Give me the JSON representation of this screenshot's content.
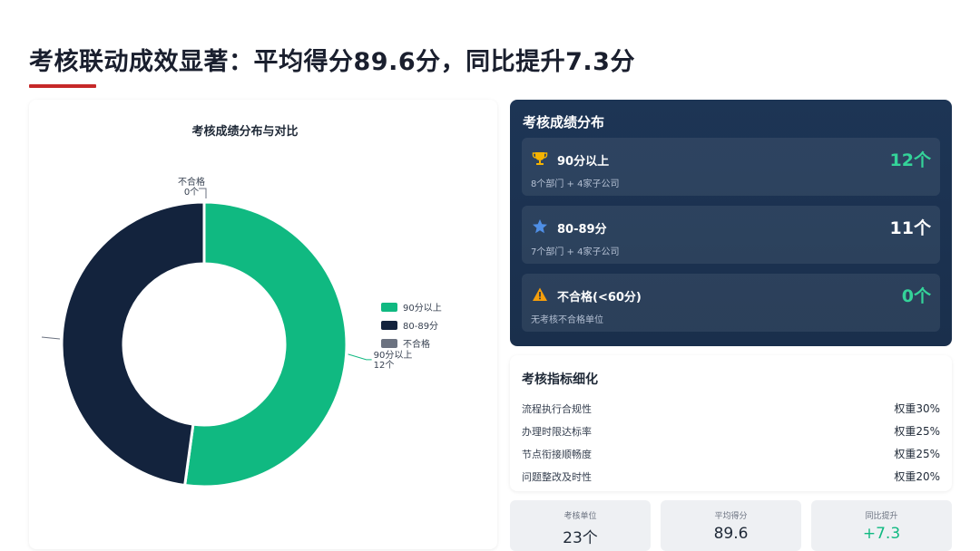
{
  "page": {
    "title": "考核联动成效显著：平均得分89.6分，同比提升7.3分"
  },
  "chart_data": {
    "type": "pie",
    "title": "考核成绩分布与对比",
    "categories": [
      "90分以上",
      "80-89分",
      "不合格"
    ],
    "values": [
      12,
      11,
      0
    ],
    "colors": [
      "#10b981",
      "#13233d",
      "#6b7280"
    ],
    "unit": "个",
    "donut": true,
    "legend": "right",
    "labels": [
      {
        "name": "90分以上",
        "value": "12个"
      },
      {
        "name": "不合格",
        "value": "0个"
      }
    ]
  },
  "distribution": {
    "title": "考核成绩分布",
    "items": [
      {
        "label": "90分以上",
        "sub": "8个部门 + 4家子公司",
        "count": "12个",
        "icon": "trophy-icon",
        "color": "#34d399"
      },
      {
        "label": "80-89分",
        "sub": "7个部门 + 4家子公司",
        "count": "11个",
        "icon": "star-icon",
        "color": "#ffffff"
      },
      {
        "label": "不合格(<60分)",
        "sub": "无考核不合格单位",
        "count": "0个",
        "icon": "warning-icon",
        "color": "#34d399"
      }
    ]
  },
  "indicators": {
    "title": "考核指标细化",
    "rows": [
      {
        "name": "流程执行合规性",
        "weight": "权重30%"
      },
      {
        "name": "办理时限达标率",
        "weight": "权重25%"
      },
      {
        "name": "节点衔接顺畅度",
        "weight": "权重25%"
      },
      {
        "name": "问题整改及时性",
        "weight": "权重20%"
      }
    ]
  },
  "stats": [
    {
      "label": "考核单位",
      "value": "23个"
    },
    {
      "label": "平均得分",
      "value": "89.6"
    },
    {
      "label": "同比提升",
      "value": "+7.3"
    }
  ]
}
